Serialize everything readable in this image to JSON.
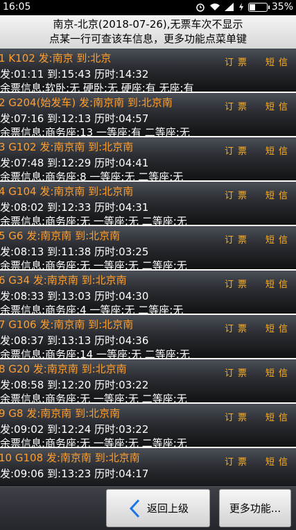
{
  "status": {
    "time": "16:05",
    "battery": "35%",
    "battery_level": 0.35
  },
  "header": {
    "line1": "南京-北京(2018-07-26),无票车次不显示",
    "line2": "点某一行可查该车信息，更多功能点菜单键"
  },
  "actions": {
    "order": "订票",
    "sms": "短信"
  },
  "trains": [
    {
      "head": "1 K102 发:南京 到:北京",
      "time": "发:01:11 到:15:43 历时:14:32",
      "tickets": "余票信息:软卧:无 硬卧:无 硬座:有 无座:有"
    },
    {
      "head": "2 G204(始发车) 发:南京南 到:北京南",
      "time": "发:07:16 到:12:13 历时:04:57",
      "tickets": "余票信息:商务座:13 一等座:有 二等座:无"
    },
    {
      "head": "3 G102 发:南京南 到:北京南",
      "time": "发:07:48 到:12:29 历时:04:41",
      "tickets": "余票信息:商务座:8 一等座:无 二等座:无"
    },
    {
      "head": "4 G104 发:南京南 到:北京南",
      "time": "发:08:02 到:12:33 历时:04:31",
      "tickets": "余票信息:商务座:无 一等座:无 二等座:无"
    },
    {
      "head": "5 G6 发:南京南 到:北京南",
      "time": "发:08:13 到:11:38 历时:03:25",
      "tickets": "余票信息:商务座:无 一等座:无 二等座:无"
    },
    {
      "head": "6 G34 发:南京南 到:北京南",
      "time": "发:08:33 到:13:03 历时:04:30",
      "tickets": "余票信息:商务座:4 一等座:无 二等座:无"
    },
    {
      "head": "7 G106 发:南京南 到:北京南",
      "time": "发:08:37 到:13:13 历时:04:36",
      "tickets": "余票信息:商务座:14 一等座:无 二等座:无"
    },
    {
      "head": "8 G20 发:南京南 到:北京南",
      "time": "发:08:58 到:12:20 历时:03:22",
      "tickets": "余票信息:商务座:无 一等座:无 二等座:无"
    },
    {
      "head": "9 G8 发:南京南 到:北京南",
      "time": "发:09:02 到:12:24 历时:03:22",
      "tickets": "余票信息:商务座:无 一等座:无 二等座:无"
    },
    {
      "head": "10 G108 发:南京南 到:北京南",
      "time": "发:09:06 到:13:23 历时:04:17",
      "tickets": ""
    }
  ],
  "footer": {
    "back": "返回上级",
    "more": "更多功能..."
  }
}
